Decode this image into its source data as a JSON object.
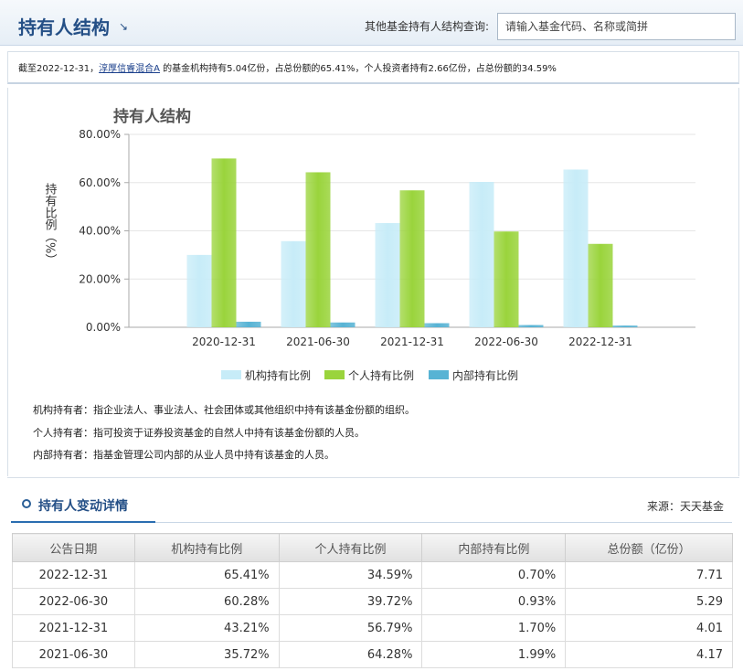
{
  "header": {
    "title": "持有人结构",
    "query_label": "其他基金持有人结构查询:",
    "search_placeholder": "请输入基金代码、名称或简拼"
  },
  "summary": {
    "prefix": "截至2022-12-31，",
    "fund_name": "淳厚信睿混合A",
    "suffix": " 的基金机构持有5.04亿份，占总份额的65.41%，个人投资者持有2.66亿份，占总份额的34.59%"
  },
  "chart_data": {
    "type": "bar",
    "title": "持有人结构",
    "ylabel": "持有比例（%）",
    "ylim": [
      0,
      80
    ],
    "yticks": [
      "0.00%",
      "20.00%",
      "40.00%",
      "60.00%",
      "80.00%"
    ],
    "categories": [
      "2020-12-31",
      "2021-06-30",
      "2021-12-31",
      "2022-06-30",
      "2022-12-31"
    ],
    "series": [
      {
        "name": "机构持有比例",
        "color": "#c7ecf8",
        "values": [
          30.0,
          35.72,
          43.21,
          60.28,
          65.41
        ]
      },
      {
        "name": "个人持有比例",
        "color": "#9ad43c",
        "values": [
          70.0,
          64.28,
          56.79,
          39.72,
          34.59
        ]
      },
      {
        "name": "内部持有比例",
        "color": "#57b3d4",
        "values": [
          2.3,
          1.99,
          1.7,
          0.93,
          0.7
        ]
      }
    ],
    "legend_position": "bottom",
    "grid": true
  },
  "notes": [
    "机构持有者：指企业法人、事业法人、社会团体或其他组织中持有该基金份额的组织。",
    "个人持有者：指可投资于证券投资基金的自然人中持有该基金份额的人员。",
    "内部持有者：指基金管理公司内部的从业人员中持有该基金的人员。"
  ],
  "details": {
    "title": "持有人变动详情",
    "source": "来源：天天基金",
    "columns": [
      "公告日期",
      "机构持有比例",
      "个人持有比例",
      "内部持有比例",
      "总份额（亿份）"
    ],
    "rows": [
      [
        "2022-12-31",
        "65.41%",
        "34.59%",
        "0.70%",
        "7.71"
      ],
      [
        "2022-06-30",
        "60.28%",
        "39.72%",
        "0.93%",
        "5.29"
      ],
      [
        "2021-12-31",
        "43.21%",
        "56.79%",
        "1.70%",
        "4.01"
      ],
      [
        "2021-06-30",
        "35.72%",
        "64.28%",
        "1.99%",
        "4.17"
      ]
    ]
  }
}
